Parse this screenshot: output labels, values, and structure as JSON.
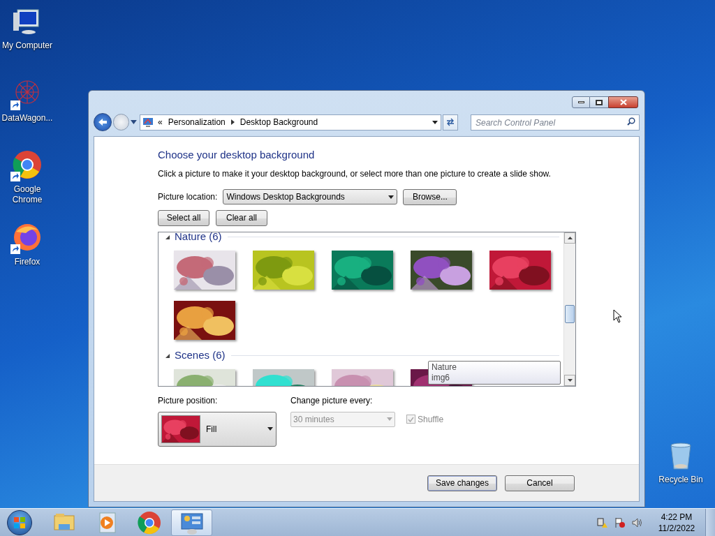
{
  "desktop_icons": [
    {
      "label": "My Computer",
      "kind": "computer",
      "shortcut": false
    },
    {
      "label": "DataWagon...",
      "kind": "datawagon",
      "shortcut": true
    },
    {
      "label": "Google Chrome",
      "kind": "chrome",
      "shortcut": true
    },
    {
      "label": "Firefox",
      "kind": "firefox",
      "shortcut": true
    },
    {
      "label": "Recycle Bin",
      "kind": "recycle",
      "shortcut": false
    }
  ],
  "window": {
    "address": {
      "overflow": "«",
      "crumbs": [
        "Personalization",
        "Desktop Background"
      ]
    },
    "search": {
      "placeholder": "Search Control Panel"
    },
    "heading": "Choose your desktop background",
    "description": "Click a picture to make it your desktop background, or select more than one picture to create a slide show.",
    "picture_location": {
      "label": "Picture location:",
      "value": "Windows Desktop Backgrounds",
      "button": "Browse..."
    },
    "select_buttons": [
      "Select all",
      "Clear all"
    ],
    "groups": [
      {
        "title": "Nature (6)",
        "expanded": true
      },
      {
        "title": "Scenes (6)",
        "expanded": true
      }
    ],
    "tooltip": [
      "Nature",
      "img6"
    ],
    "picture_position": {
      "label": "Picture position:",
      "value": "Fill"
    },
    "change_every": {
      "label": "Change picture every:",
      "value": "30 minutes",
      "disabled": true
    },
    "shuffle": {
      "label": "Shuffle",
      "checked": true,
      "disabled": true
    },
    "buttons": [
      "Save changes",
      "Cancel"
    ]
  },
  "taskbar": {
    "items": [
      {
        "kind": "explorer",
        "selected": false
      },
      {
        "kind": "media",
        "selected": false
      },
      {
        "kind": "chrome",
        "selected": false
      },
      {
        "kind": "controlpanel",
        "selected": true
      }
    ],
    "time": "4:22 PM",
    "date": "11/2/2022"
  }
}
